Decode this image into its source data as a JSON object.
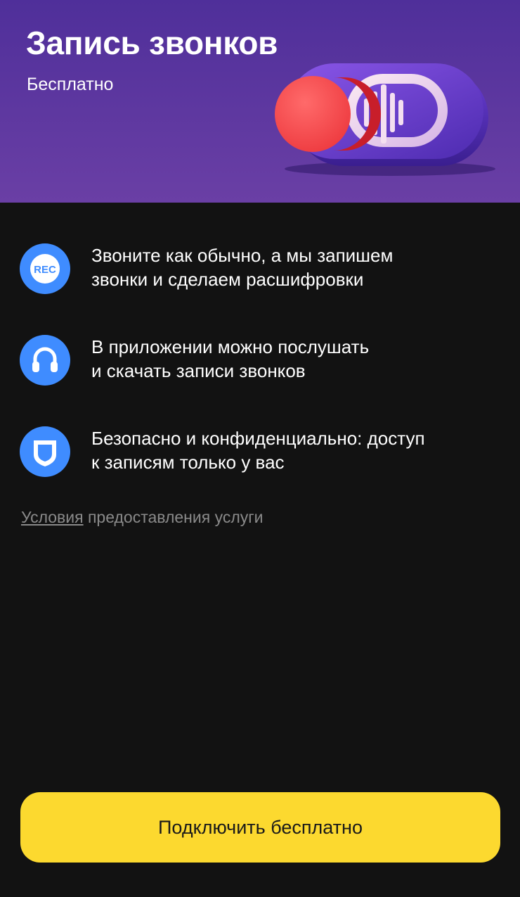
{
  "hero": {
    "title": "Запись звонков",
    "subtitle": "Бесплатно",
    "background_color": "#5a34a0",
    "illustration": "record-toggle-illustration"
  },
  "features": [
    {
      "icon": "rec-icon",
      "text": "Звоните как обычно, а мы запишем\nзвонки и сделаем расшифровки"
    },
    {
      "icon": "headphones-icon",
      "text": "В приложении можно послушать\nи скачать записи звонков"
    },
    {
      "icon": "shield-icon",
      "text": "Безопасно и конфиденциально: доступ\nк записям только у вас"
    }
  ],
  "terms": {
    "link_label": "Условия",
    "rest_text": " предоставления услуги"
  },
  "cta": {
    "label": "Подключить бесплатно",
    "color": "#fcd92f"
  },
  "colors": {
    "background": "#121212",
    "icon_accent": "#3f8cff",
    "record_red": "#ff4a4a"
  }
}
